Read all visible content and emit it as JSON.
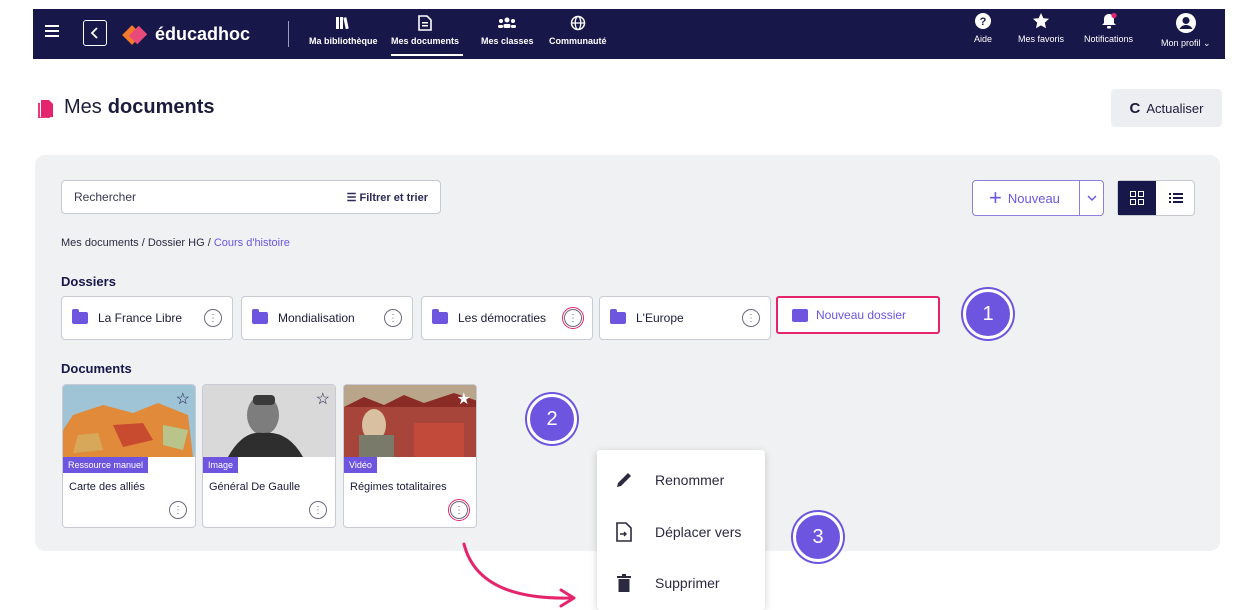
{
  "nav": {
    "brand": "éducadhoc",
    "items": [
      {
        "label": "Ma bibliothèque",
        "icon": "book-icon"
      },
      {
        "label": "Mes documents",
        "icon": "document-icon",
        "active": true
      },
      {
        "label": "Mes classes",
        "icon": "group-icon"
      },
      {
        "label": "Communauté",
        "icon": "globe-icon"
      }
    ],
    "right": [
      {
        "label": "Aide",
        "icon": "help-icon"
      },
      {
        "label": "Mes favoris",
        "icon": "star-icon"
      },
      {
        "label": "Notifications",
        "icon": "bell-icon"
      },
      {
        "label": "Mon profil",
        "icon": "user-icon"
      }
    ]
  },
  "page": {
    "title_plain": "Mes",
    "title_bold": "documents",
    "refresh_label": "Actualiser"
  },
  "toolbar": {
    "search_placeholder": "Rechercher",
    "filter_label": "Filtrer et trier",
    "new_label": "Nouveau"
  },
  "breadcrumb": {
    "part1": "Mes documents / Dossier HG / ",
    "current": "Cours d'histoire"
  },
  "folders": {
    "heading": "Dossiers",
    "items": [
      "La France Libre",
      "Mondialisation",
      "Les démocraties",
      "L'Europe"
    ],
    "new_folder_label": "Nouveau dossier"
  },
  "documents": {
    "heading": "Documents",
    "items": [
      {
        "name": "Carte des alliés",
        "tag": "Ressource manuel",
        "favorite": false
      },
      {
        "name": "Général De Gaulle",
        "tag": "Image",
        "favorite": false
      },
      {
        "name": "Régimes totalitaires",
        "tag": "Vidéo",
        "favorite": true
      }
    ]
  },
  "context_menu": {
    "items": [
      "Renommer",
      "Déplacer vers",
      "Supprimer"
    ]
  },
  "callouts": [
    "1",
    "2",
    "3"
  ],
  "colors": {
    "navy": "#18174a",
    "accent": "#6d55e0",
    "highlight": "#e5246e"
  }
}
